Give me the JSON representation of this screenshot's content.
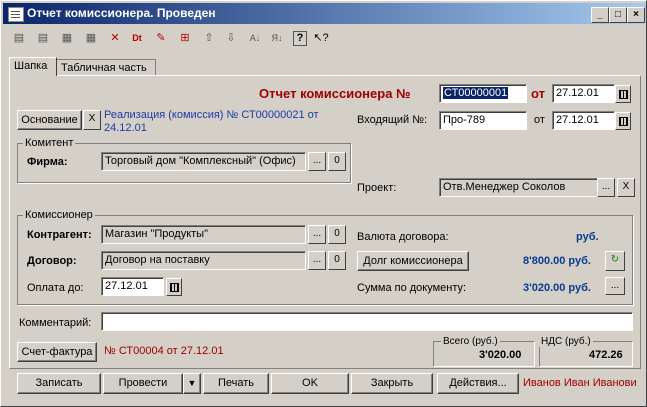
{
  "window": {
    "title": "Отчет комиссионера. Проведен"
  },
  "tabs": [
    "Шапка",
    "Табличная часть"
  ],
  "header": {
    "doc_title": "Отчет комиссионера №",
    "doc_number": "СТ00000001",
    "date_label": "от",
    "doc_date": "27.12.01",
    "incoming_label": "Входящий №:",
    "incoming_number": "Про-789",
    "incoming_date_label": "от",
    "incoming_date": "27.12.01"
  },
  "basis": {
    "button": "Основание",
    "clear": "X",
    "text": "Реализация (комиссия) № СТ00000021 от 24.12.01"
  },
  "komitent": {
    "group_label": "Комитент",
    "firm_label": "Фирма:",
    "firm_value": "Торговый дом \"Комплексный\" (Офис)",
    "dots": "...",
    "zero": "0"
  },
  "project": {
    "label": "Проект:",
    "value": "Отв.Менеджер Соколов",
    "dots": "...",
    "clear": "X"
  },
  "komissioner": {
    "group_label": "Комиссионер",
    "contractor_label": "Контрагент:",
    "contractor_value": "Магазин \"Продукты\"",
    "contract_label": "Договор:",
    "contract_value": "Договор на поставку",
    "pay_label": "Оплата до:",
    "pay_date": "27.12.01",
    "dots": "...",
    "zero": "0",
    "currency_label": "Валюта договора:",
    "currency_value": "руб.",
    "debt_button": "Долг комиссионера",
    "debt_value": "8'800.00 руб.",
    "sum_label": "Сумма по документу:",
    "sum_value": "3'020.00 руб."
  },
  "comment": {
    "label": "Комментарий:",
    "value": ""
  },
  "invoice": {
    "button": "Счет-фактура",
    "text": "№ СТ00004 от 27.12.01"
  },
  "totals": {
    "total_label": "Всего (руб.)",
    "total_value": "3'020.00",
    "vat_label": "НДС (руб.)",
    "vat_value": "472.26"
  },
  "footer": {
    "write": "Записать",
    "post": "Провести",
    "print": "Печать",
    "ok": "OK",
    "close": "Закрыть",
    "actions": "Действия...",
    "user": "Иванов Иван Иванови"
  },
  "toolbar_icons": [
    "new-row-icon",
    "copy-row-icon",
    "edit-row-icon",
    "delete-row-icon",
    "mark-delete-icon",
    "dt-icon",
    "check-icon",
    "structure-icon",
    "move-up-icon",
    "move-down-icon",
    "sort-asc-icon",
    "sort-desc-icon",
    "help-icon",
    "context-help-icon"
  ],
  "colors": {
    "title_start": "#0a246a",
    "title_end": "#a6caf0",
    "doc_title": "#a00000",
    "amount": "#0a3b8f"
  }
}
